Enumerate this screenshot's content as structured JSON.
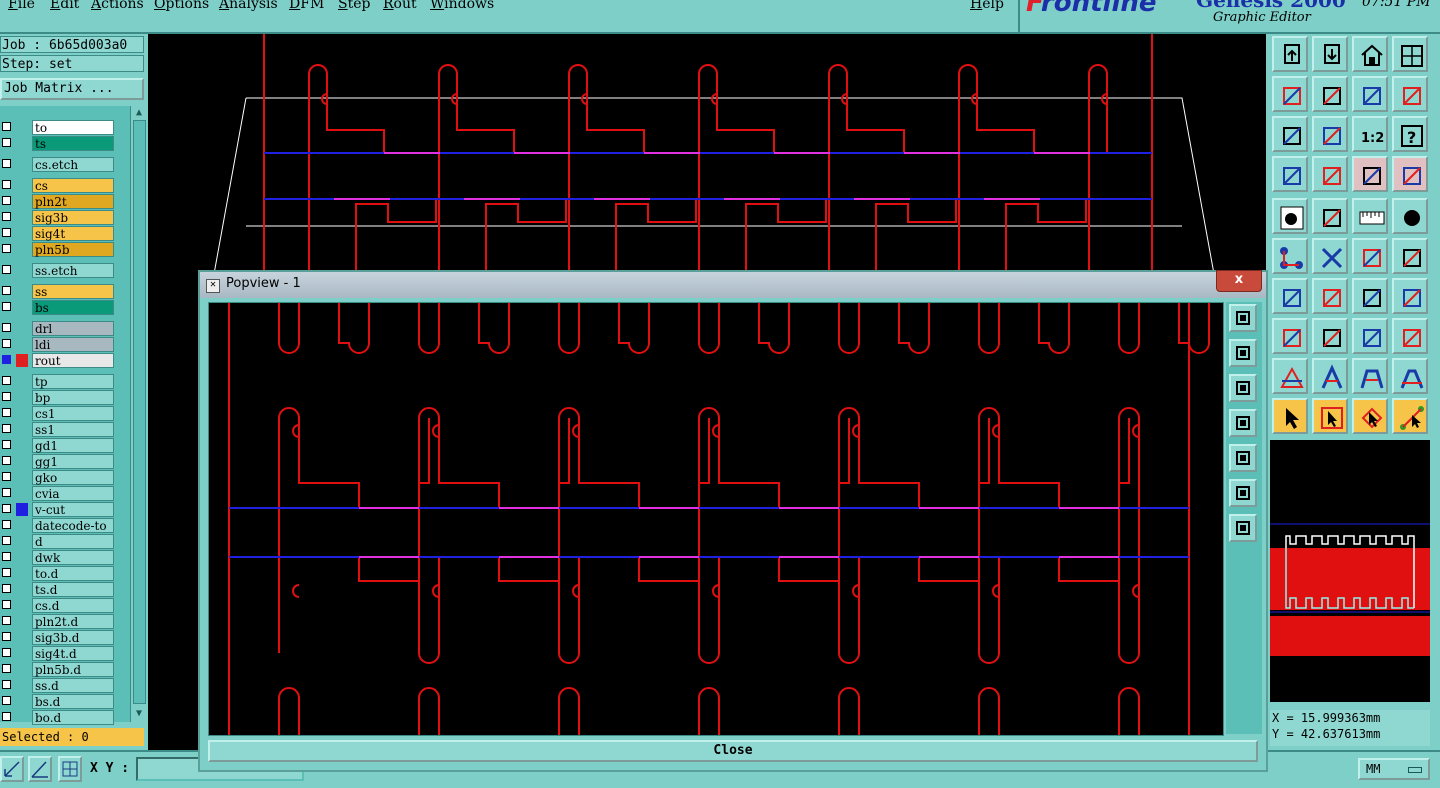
{
  "menu": {
    "items": [
      "File",
      "Edit",
      "Actions",
      "Options",
      "Analysis",
      "DFM",
      "Step",
      "Rout",
      "Windows"
    ],
    "help": "Help"
  },
  "brand": {
    "logo_f": "F",
    "logo_rest": "rontline",
    "version": "Genesis 2000",
    "subtitle": "Graphic Editor",
    "time": "07:51 PM"
  },
  "job": {
    "job_label": "Job : 6b65d003a0",
    "step_label": "Step: set",
    "job_matrix": "Job Matrix ..."
  },
  "layers": [
    {
      "name": "to",
      "bg": "#ffffff",
      "cb": "normal"
    },
    {
      "name": "ts",
      "bg": "#0a9a7a",
      "cb": "normal"
    },
    {
      "name": "cs.etch",
      "bg": "#8fd8d2",
      "cb": "normal"
    },
    {
      "name": "cs",
      "bg": "#f7c44a",
      "cb": "normal"
    },
    {
      "name": "pln2t",
      "bg": "#e0a820",
      "cb": "normal"
    },
    {
      "name": "sig3b",
      "bg": "#f7c44a",
      "cb": "normal"
    },
    {
      "name": "sig4t",
      "bg": "#f7c44a",
      "cb": "normal"
    },
    {
      "name": "pln5b",
      "bg": "#e0a820",
      "cb": "normal"
    },
    {
      "name": "ss.etch",
      "bg": "#8fd8d2",
      "cb": "normal"
    },
    {
      "name": "ss",
      "bg": "#f7c44a",
      "cb": "normal"
    },
    {
      "name": "bs",
      "bg": "#0a9a7a",
      "cb": "normal"
    },
    {
      "name": "drl",
      "bg": "#a8b8c0",
      "cb": "normal"
    },
    {
      "name": "ldi",
      "bg": "#a8b8c0",
      "cb": "normal"
    },
    {
      "name": "rout",
      "bg": "#e8e8e8",
      "cb": "blue",
      "swatch": "#e02020"
    },
    {
      "name": "tp",
      "bg": "#8fd8d2",
      "cb": "normal"
    },
    {
      "name": "bp",
      "bg": "#8fd8d2",
      "cb": "normal"
    },
    {
      "name": "cs1",
      "bg": "#8fd8d2",
      "cb": "normal"
    },
    {
      "name": "ss1",
      "bg": "#8fd8d2",
      "cb": "normal"
    },
    {
      "name": "gd1",
      "bg": "#8fd8d2",
      "cb": "normal"
    },
    {
      "name": "gg1",
      "bg": "#8fd8d2",
      "cb": "normal"
    },
    {
      "name": "gko",
      "bg": "#8fd8d2",
      "cb": "normal"
    },
    {
      "name": "cvia",
      "bg": "#8fd8d2",
      "cb": "normal"
    },
    {
      "name": "v-cut",
      "bg": "#8fd8d2",
      "cb": "normal",
      "swatch": "#2020e0"
    },
    {
      "name": "datecode-to",
      "bg": "#8fd8d2",
      "cb": "normal"
    },
    {
      "name": "d",
      "bg": "#8fd8d2",
      "cb": "normal"
    },
    {
      "name": "dwk",
      "bg": "#8fd8d2",
      "cb": "normal"
    },
    {
      "name": "to.d",
      "bg": "#8fd8d2",
      "cb": "normal"
    },
    {
      "name": "ts.d",
      "bg": "#8fd8d2",
      "cb": "normal"
    },
    {
      "name": "cs.d",
      "bg": "#8fd8d2",
      "cb": "normal"
    },
    {
      "name": "pln2t.d",
      "bg": "#8fd8d2",
      "cb": "normal"
    },
    {
      "name": "sig3b.d",
      "bg": "#8fd8d2",
      "cb": "normal"
    },
    {
      "name": "sig4t.d",
      "bg": "#8fd8d2",
      "cb": "normal"
    },
    {
      "name": "pln5b.d",
      "bg": "#8fd8d2",
      "cb": "normal"
    },
    {
      "name": "ss.d",
      "bg": "#8fd8d2",
      "cb": "normal"
    },
    {
      "name": "bs.d",
      "bg": "#8fd8d2",
      "cb": "normal"
    },
    {
      "name": "bo.d",
      "bg": "#8fd8d2",
      "cb": "normal"
    }
  ],
  "selected_label": "Selected : 0",
  "bottom": {
    "xy_label": "X Y :",
    "xy_value": "",
    "units": "MM"
  },
  "coords": {
    "x": "X = 15.999363mm",
    "y": "Y = 42.637613mm"
  },
  "popview": {
    "title": "Popview - 1",
    "close_x": "x",
    "close_button": "Close"
  },
  "toolbar_icons": [
    "load-icon",
    "save-icon",
    "home-icon",
    "grid-icon",
    "prev-icon",
    "next-icon",
    "undo-icon",
    "redraw-icon",
    "zoom-fit-icon",
    "zoom-pan-icon",
    "scale-1-2-icon",
    "help-icon",
    "tools-icon",
    "snap-icon",
    "compare-icon",
    "compare2-icon",
    "pad-icon",
    "line-icon",
    "ruler-icon",
    "circle-icon",
    "connect-icon",
    "cross-icon",
    "arrow-pad-icon",
    "arrow-pad2-icon",
    "angle-icon",
    "diagonal-icon",
    "rotate-icon",
    "flip-icon",
    "pad-select-icon",
    "minus-icon",
    "dimension-icon",
    "cluster-icon",
    "triangle-icon",
    "arc-icon",
    "arch-icon",
    "measure-icon",
    "pointer-icon",
    "pointer2-icon",
    "pointer3-icon",
    "node-edit-icon"
  ],
  "colors": {
    "panel": "#7fcfc9",
    "rout": "#e01010",
    "vcut": "#2020e0",
    "highlight": "#e030e0",
    "profile": "#ffffff"
  }
}
